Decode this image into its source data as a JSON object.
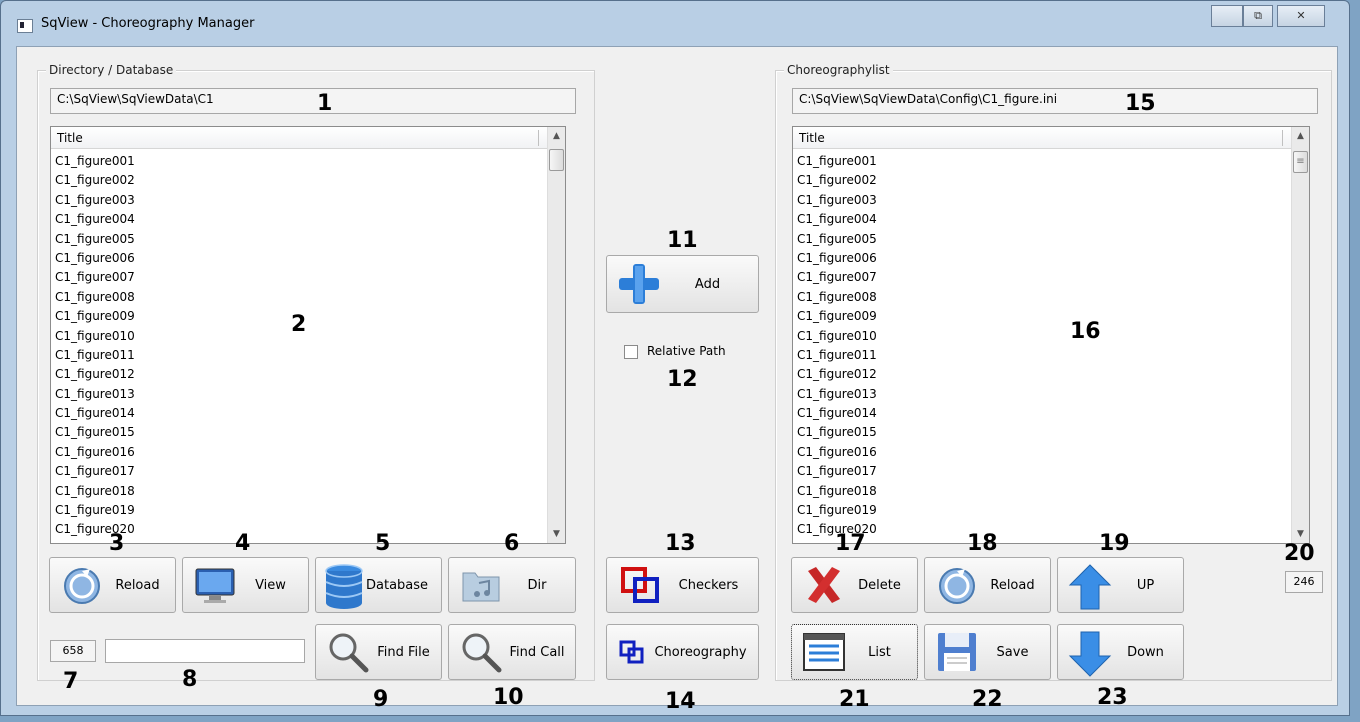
{
  "window": {
    "title": "SqView - Choreography Manager",
    "controls": {
      "minimize": "",
      "maximize": "⧉",
      "close": "✕"
    }
  },
  "left": {
    "group_label": "Directory / Database",
    "path": "C:\\SqView\\SqViewData\\C1",
    "list_header": "Title",
    "items": [
      "C1_figure001",
      "C1_figure002",
      "C1_figure003",
      "C1_figure004",
      "C1_figure005",
      "C1_figure006",
      "C1_figure007",
      "C1_figure008",
      "C1_figure009",
      "C1_figure010",
      "C1_figure011",
      "C1_figure012",
      "C1_figure013",
      "C1_figure014",
      "C1_figure015",
      "C1_figure016",
      "C1_figure017",
      "C1_figure018",
      "C1_figure019",
      "C1_figure020"
    ],
    "buttons": {
      "reload": "Reload",
      "view": "View",
      "database": "Database",
      "dir": "Dir",
      "find_file": "Find File",
      "find_call": "Find Call"
    },
    "count": "658",
    "search_value": ""
  },
  "middle": {
    "add": "Add",
    "relative_path": "Relative Path",
    "checkers": "Checkers",
    "choreography": "Choreography"
  },
  "right": {
    "group_label": "Choreographylist",
    "path": "C:\\SqView\\SqViewData\\Config\\C1_figure.ini",
    "list_header": "Title",
    "items": [
      "C1_figure001",
      "C1_figure002",
      "C1_figure003",
      "C1_figure004",
      "C1_figure005",
      "C1_figure006",
      "C1_figure007",
      "C1_figure008",
      "C1_figure009",
      "C1_figure010",
      "C1_figure011",
      "C1_figure012",
      "C1_figure013",
      "C1_figure014",
      "C1_figure015",
      "C1_figure016",
      "C1_figure017",
      "C1_figure018",
      "C1_figure019",
      "C1_figure020"
    ],
    "buttons": {
      "delete": "Delete",
      "reload": "Reload",
      "up": "UP",
      "list": "List",
      "save": "Save",
      "down": "Down"
    },
    "count": "246"
  },
  "callouts": [
    "1",
    "2",
    "3",
    "4",
    "5",
    "6",
    "7",
    "8",
    "9",
    "10",
    "11",
    "12",
    "13",
    "14",
    "15",
    "16",
    "17",
    "18",
    "19",
    "20",
    "21",
    "22",
    "23"
  ],
  "colors": {
    "accent_blue": "#3a8ee6",
    "delete_red": "#c62828",
    "checkers_red": "#d01010",
    "checkers_blue": "#1020c0"
  }
}
